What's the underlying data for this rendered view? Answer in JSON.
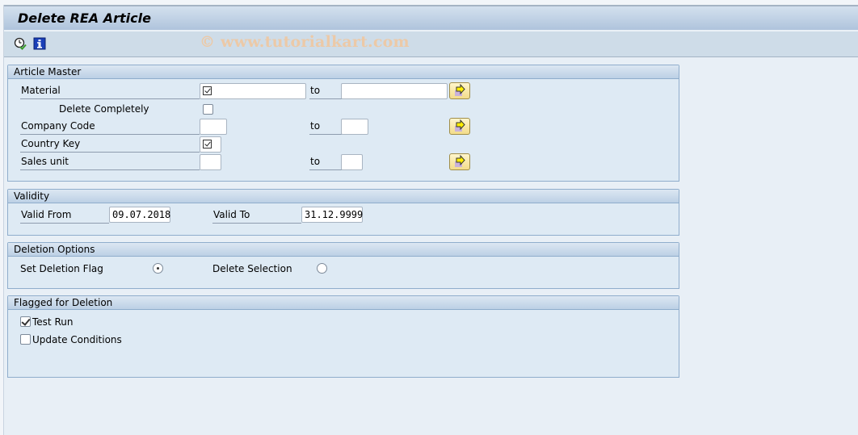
{
  "window": {
    "title": "Delete REA Article",
    "watermark": "© www.tutorialkart.com"
  },
  "toolbar": {
    "items": [
      {
        "icon": "execute-clock-icon",
        "tooltip": "Execute"
      },
      {
        "icon": "info-icon",
        "tooltip": "Information"
      }
    ]
  },
  "groups": {
    "article_master": {
      "title": "Article Master",
      "to_label": "to",
      "rows": {
        "material": {
          "label": "Material",
          "from_value": "",
          "to_value": "",
          "required_check": true
        },
        "delete_completely": {
          "label": "Delete Completely",
          "checked": false
        },
        "company_code": {
          "label": "Company Code",
          "from_value": "",
          "to_value": ""
        },
        "country_key": {
          "label": "Country Key",
          "value": "",
          "required_check": true
        },
        "sales_unit": {
          "label": "Sales unit",
          "from_value": "",
          "to_value": ""
        }
      }
    },
    "validity": {
      "title": "Validity",
      "valid_from_label": "Valid From",
      "valid_from_value": "09.07.2018",
      "valid_to_label": "Valid To",
      "valid_to_value": "31.12.9999"
    },
    "deletion_options": {
      "title": "Deletion Options",
      "set_deletion_flag_label": "Set Deletion Flag",
      "set_deletion_flag_selected": true,
      "delete_selection_label": "Delete Selection",
      "delete_selection_selected": false
    },
    "flagged_for_deletion": {
      "title": "Flagged for Deletion",
      "test_run_label": "Test Run",
      "test_run_checked": true,
      "update_conditions_label": "Update Conditions",
      "update_conditions_checked": false
    }
  },
  "colors": {
    "title_bar": "#afc4dc",
    "group_border": "#8fadcc",
    "group_bg": "#deeaf4",
    "multi_button": "#f3dc8a"
  }
}
